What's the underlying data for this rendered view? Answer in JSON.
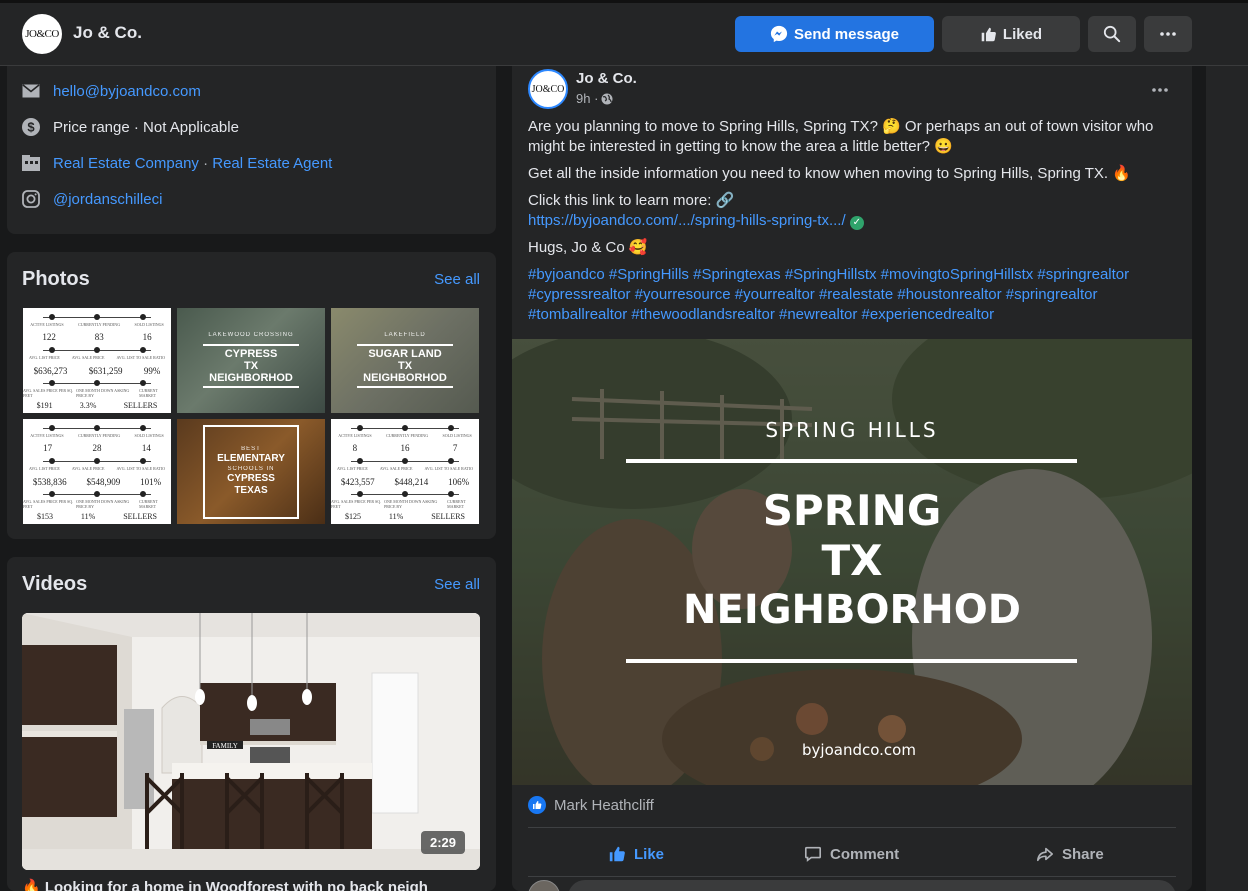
{
  "header": {
    "logo_text": "JO&CO",
    "page_name": "Jo & Co.",
    "send_message": "Send message",
    "liked": "Liked"
  },
  "intro": {
    "email": "hello@byjoandco.com",
    "price_range": "Price range · Not Applicable",
    "category_1": "Real Estate Company",
    "category_sep": " · ",
    "category_2": "Real Estate Agent",
    "instagram": "@jordanschilleci"
  },
  "photos": {
    "title": "Photos",
    "see_all": "See all",
    "stat_labels": [
      "ACTIVE LISTINGS",
      "CURRENTLY PENDING",
      "SOLD LISTINGS"
    ],
    "stat_labels_2": [
      "AVG. LIST PRICE",
      "AVG. SALE PRICE",
      "AVG. LIST TO SALE RATIO"
    ],
    "stat_labels_3": [
      "AVG. SALES PRICE PER SQ. FEET",
      "ONE MONTH DOWN ASKING PRICE BY",
      "CURRENT MARKET"
    ],
    "stats_1": {
      "r1": [
        "122",
        "83",
        "16"
      ],
      "r2": [
        "$636,273",
        "$631,259",
        "99%"
      ],
      "r3": [
        "$191",
        "3.3%",
        "SELLERS"
      ]
    },
    "stats_2": {
      "r1": [
        "17",
        "28",
        "14"
      ],
      "r2": [
        "$538,836",
        "$548,909",
        "101%"
      ],
      "r3": [
        "$153",
        "11%",
        "SELLERS"
      ]
    },
    "stats_3": {
      "r1": [
        "8",
        "16",
        "7"
      ],
      "r2": [
        "$423,557",
        "$448,214",
        "106%"
      ],
      "r3": [
        "$125",
        "11%",
        "SELLERS"
      ]
    },
    "cypress": {
      "small": "LAKEWOOD CROSSING",
      "l1": "CYPRESS",
      "l2": "TX",
      "l3": "NEIGHBORHOD"
    },
    "sugarland": {
      "small": "LAKEFIELD",
      "l1": "SUGAR LAND",
      "l2": "TX",
      "l3": "NEIGHBORHOD"
    },
    "schools": {
      "l0": "BEST",
      "l1": "ELEMENTARY",
      "l2": "SCHOOLS IN",
      "l3": "CYPRESS",
      "l4": "TEXAS"
    }
  },
  "videos": {
    "title": "Videos",
    "see_all": "See all",
    "duration": "2:29",
    "sign": "FAMILY",
    "caption": "Looking for a home in Woodforest with no back neigh"
  },
  "post": {
    "avatar_text": "JO&CO",
    "author": "Jo & Co.",
    "time": "9h ·",
    "p1": "Are you planning to move to Spring Hills, Spring TX? 🤔 Or perhaps an out of town visitor who might be interested in getting to know the area a little better? 😀",
    "p2": "Get all the inside information you need to know when moving to Spring Hills, Spring TX. 🔥",
    "p3": "Click this link to learn more: 🔗",
    "link": "https://byjoandco.com/.../spring-hills-spring-tx.../",
    "p4": "Hugs, Jo & Co 🥰",
    "hashtags": "#byjoandco #SpringHills #Springtexas #SpringHillstx #movingtoSpringHillstx #springrealtor #cypressrealtor #yourresource #yourrealtor #realestate #houstonrealtor #springrealtor #tomballrealtor #thewoodlandsrealtor #newrealtor #experiencedrealtor",
    "image": {
      "top": "SPRING HILLS",
      "l1": "SPRING",
      "l2": "TX",
      "l3": "NEIGHBORHOD",
      "site": "byjoandco.com"
    },
    "reactor": "Mark Heathcliff",
    "like": "Like",
    "comment": "Comment",
    "share": "Share"
  },
  "colors": {
    "accent": "#2374e1",
    "link": "#4599ff",
    "card": "#242526",
    "background": "#18191a"
  }
}
